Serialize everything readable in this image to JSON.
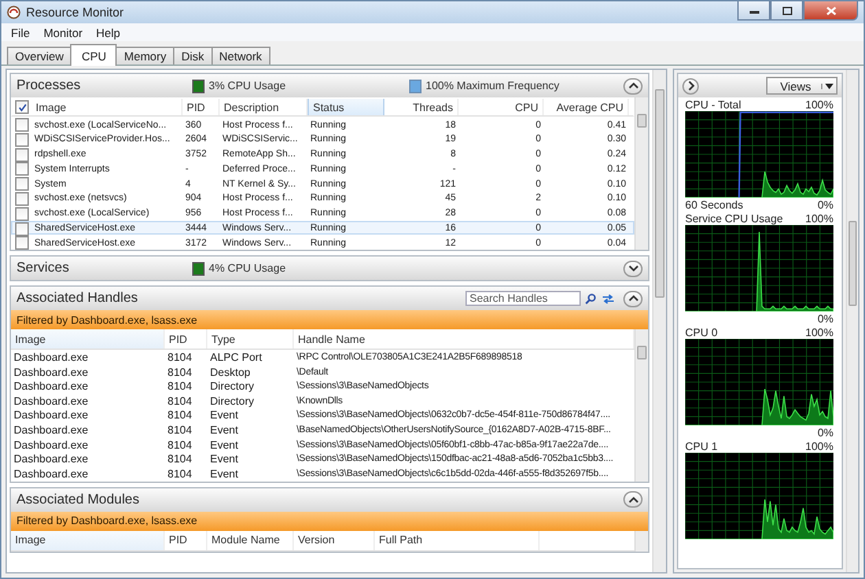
{
  "window": {
    "title": "Resource Monitor"
  },
  "menu": [
    "File",
    "Monitor",
    "Help"
  ],
  "tabs": [
    {
      "label": "Overview",
      "selected": false
    },
    {
      "label": "CPU",
      "selected": true
    },
    {
      "label": "Memory",
      "selected": false
    },
    {
      "label": "Disk",
      "selected": false
    },
    {
      "label": "Network",
      "selected": false
    }
  ],
  "processes": {
    "title": "Processes",
    "expanded": true,
    "cpu_usage": "3% CPU Usage",
    "max_frequency": "100% Maximum Frequency",
    "all_checked": true,
    "columns": [
      {
        "label": "Image",
        "sorted": false
      },
      {
        "label": "PID",
        "sorted": false
      },
      {
        "label": "Description",
        "sorted": false
      },
      {
        "label": "Status",
        "sorted": true
      },
      {
        "label": "Threads",
        "sorted": false
      },
      {
        "label": "CPU",
        "sorted": false
      },
      {
        "label": "Average CPU",
        "sorted": false
      }
    ],
    "rows": [
      {
        "checked": false,
        "selected": false,
        "cells": [
          "svchost.exe (LocalServiceNo...",
          "360",
          "Host Process f...",
          "Running",
          "18",
          "0",
          "0.41"
        ]
      },
      {
        "checked": false,
        "selected": false,
        "cells": [
          "WDiSCSIServiceProvider.Hos...",
          "2604",
          "WDiSCSIServic...",
          "Running",
          "19",
          "0",
          "0.30"
        ]
      },
      {
        "checked": false,
        "selected": false,
        "cells": [
          "rdpshell.exe",
          "3752",
          "RemoteApp Sh...",
          "Running",
          "8",
          "0",
          "0.24"
        ]
      },
      {
        "checked": false,
        "selected": false,
        "cells": [
          "System Interrupts",
          "-",
          "Deferred Proce...",
          "Running",
          "-",
          "0",
          "0.12"
        ]
      },
      {
        "checked": false,
        "selected": false,
        "cells": [
          "System",
          "4",
          "NT Kernel & Sy...",
          "Running",
          "121",
          "0",
          "0.10"
        ]
      },
      {
        "checked": false,
        "selected": false,
        "cells": [
          "svchost.exe (netsvcs)",
          "904",
          "Host Process f...",
          "Running",
          "45",
          "2",
          "0.10"
        ]
      },
      {
        "checked": false,
        "selected": false,
        "cells": [
          "svchost.exe (LocalService)",
          "956",
          "Host Process f...",
          "Running",
          "28",
          "0",
          "0.08"
        ]
      },
      {
        "checked": false,
        "selected": true,
        "cells": [
          "SharedServiceHost.exe",
          "3444",
          "Windows Serv...",
          "Running",
          "16",
          "0",
          "0.05"
        ]
      },
      {
        "checked": false,
        "selected": false,
        "cells": [
          "SharedServiceHost.exe",
          "3172",
          "Windows Serv...",
          "Running",
          "12",
          "0",
          "0.04"
        ]
      }
    ]
  },
  "services": {
    "title": "Services",
    "expanded": false,
    "cpu_usage": "4% CPU Usage"
  },
  "handles": {
    "title": "Associated Handles",
    "expanded": true,
    "search": {
      "placeholder": "Search Handles"
    },
    "filter": "Filtered by Dashboard.exe, lsass.exe",
    "columns": [
      {
        "label": "Image",
        "sorted": true
      },
      {
        "label": "PID",
        "sorted": false
      },
      {
        "label": "Type",
        "sorted": false
      },
      {
        "label": "Handle Name",
        "sorted": false
      }
    ],
    "rows": [
      [
        "Dashboard.exe",
        "8104",
        "ALPC Port",
        "\\RPC Control\\OLE703805A1C3E241A2B5F689898518"
      ],
      [
        "Dashboard.exe",
        "8104",
        "Desktop",
        "\\Default"
      ],
      [
        "Dashboard.exe",
        "8104",
        "Directory",
        "\\Sessions\\3\\BaseNamedObjects"
      ],
      [
        "Dashboard.exe",
        "8104",
        "Directory",
        "\\KnownDlls"
      ],
      [
        "Dashboard.exe",
        "8104",
        "Event",
        "\\Sessions\\3\\BaseNamedObjects\\0632c0b7-dc5e-454f-811e-750d86784f47...."
      ],
      [
        "Dashboard.exe",
        "8104",
        "Event",
        "\\BaseNamedObjects\\OtherUsersNotifySource_{0162A8D7-A02B-4715-8BF..."
      ],
      [
        "Dashboard.exe",
        "8104",
        "Event",
        "\\Sessions\\3\\BaseNamedObjects\\05f60bf1-c8bb-47ac-b85a-9f17ae22a7de...."
      ],
      [
        "Dashboard.exe",
        "8104",
        "Event",
        "\\Sessions\\3\\BaseNamedObjects\\150dfbac-ac21-48a8-a5d6-7052ba1c5bb3...."
      ],
      [
        "Dashboard.exe",
        "8104",
        "Event",
        "\\Sessions\\3\\BaseNamedObjects\\c6c1b5dd-02da-446f-a555-f8d352697f5b...."
      ]
    ]
  },
  "modules": {
    "title": "Associated Modules",
    "expanded": true,
    "filter": "Filtered by Dashboard.exe, lsass.exe",
    "columns": [
      {
        "label": "Image",
        "sorted": true
      },
      {
        "label": "PID",
        "sorted": false
      },
      {
        "label": "Module Name",
        "sorted": false
      },
      {
        "label": "Version",
        "sorted": false
      },
      {
        "label": "Full Path",
        "sorted": false
      }
    ]
  },
  "graphs_panel": {
    "views_button": "Views",
    "graphs": [
      {
        "title": "CPU - Total",
        "max": "100%",
        "min": "0%",
        "footer": "60 Seconds"
      },
      {
        "title": "Service CPU Usage",
        "max": "100%",
        "min": "0%"
      },
      {
        "title": "CPU 0",
        "max": "100%",
        "min": "0%"
      },
      {
        "title": "CPU 1",
        "max": "100%"
      }
    ]
  }
}
